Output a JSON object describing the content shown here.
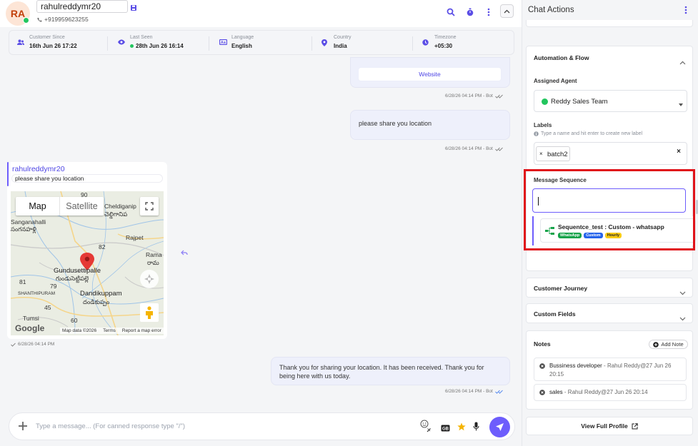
{
  "contact": {
    "initials": "RA",
    "name": "rahulreddymr20",
    "phone": "+919959623255"
  },
  "info": [
    {
      "label": "Customer Since",
      "value": "16th Jun 26 17:22",
      "icon": "users-icon"
    },
    {
      "label": "Last Seen",
      "value": "28th Jun 26 16:14",
      "icon": "eye-icon"
    },
    {
      "label": "Language",
      "value": "English",
      "icon": "language-icon"
    },
    {
      "label": "Country",
      "value": "India",
      "icon": "location-pin-icon"
    },
    {
      "label": "Timezone",
      "value": "+05:30",
      "icon": "clock-icon"
    }
  ],
  "messages": {
    "website_button": "Website",
    "ts1": "6/28/26 04:14 PM - Bot",
    "out1": "please share you location",
    "ts2": "6/28/26 04:14 PM - Bot",
    "in_sender": "rahulreddymr20",
    "in_quote": "please share you location",
    "in_ts": "6/28/26 04:14 PM",
    "out2": "Thank you for sharing your location. It has been received. Thank you for being here with us today.",
    "ts3": "6/28/26 04:14 PM - Bot"
  },
  "map": {
    "tab_map": "Map",
    "tab_satellite": "Satellite",
    "labels": {
      "sanganahalli": "Sanganahalli",
      "sanganahalli_te": "సంగనహళ్లి",
      "cheldiganip": "Cheldiganip",
      "cheldiganip_te": "చెల్డిగానిప",
      "rajpet": "Rajpet",
      "rama": "Rama",
      "rama_te": "రామ",
      "gundusettipalle": "Gundusettipalle",
      "gundusettipalle_te": "గుండుసెట్టిపల్లె",
      "shanthipuram": "SHANTHIPURAM",
      "dandikuppam": "Dandikuppam",
      "dandikuppam_te": "దండికుప్పం",
      "tumsi": "Tumsi",
      "r90": "90",
      "r82": "82",
      "r81": "81",
      "r79": "79",
      "r45": "45",
      "r60": "60"
    },
    "google": "Google",
    "map_data": "Map data ©2026",
    "terms": "Terms",
    "report": "Report a map error"
  },
  "composer": {
    "placeholder": "Type a message... (For canned response type \"/\")"
  },
  "side": {
    "title": "Chat Actions",
    "automation_title": "Automation & Flow",
    "assigned_agent_label": "Assigned Agent",
    "assigned_agent_value": "Reddy Sales Team",
    "labels_label": "Labels",
    "labels_hint": "Type a name and hit enter to create new label",
    "label_chip": "batch2",
    "message_sequence_label": "Message Sequence",
    "sequence": {
      "title": "Sequentce_test : Custom - whatsapp",
      "badges": [
        "WhatsApp",
        "Custom",
        "Hourly"
      ]
    },
    "customer_journey": "Customer Journey",
    "custom_fields": "Custom Fields",
    "notes_title": "Notes",
    "add_note": "Add Note",
    "notes": [
      {
        "text": "Bussiness developer",
        "meta": " - Rahul Reddy@27 Jun 26 20:15"
      },
      {
        "text": "sales",
        "meta": " - Rahul Reddy@27 Jun 26 20:14"
      }
    ],
    "view_full_profile": "View Full Profile"
  },
  "colors": {
    "accent": "#6d5dfc",
    "online": "#22c55e",
    "highlight_border": "#e0131a",
    "badge_whatsapp": "#16a34a",
    "badge_custom": "#2563eb",
    "badge_hourly": "#facc15"
  }
}
